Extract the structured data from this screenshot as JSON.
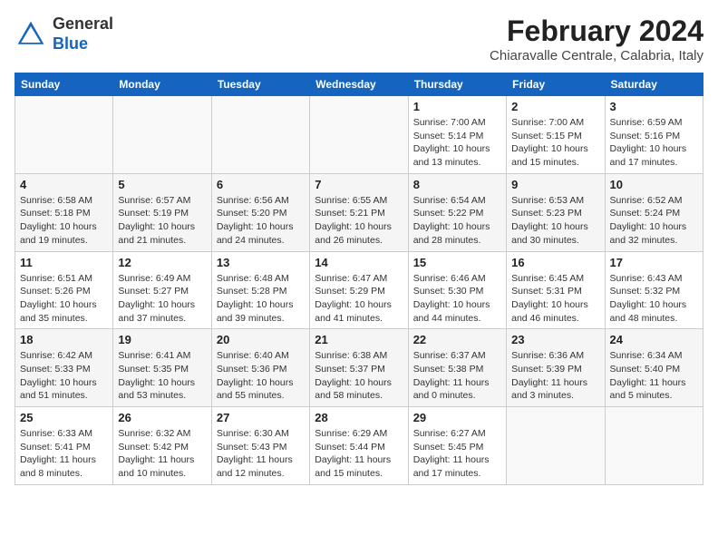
{
  "logo": {
    "general": "General",
    "blue": "Blue"
  },
  "title": "February 2024",
  "subtitle": "Chiaravalle Centrale, Calabria, Italy",
  "days_of_week": [
    "Sunday",
    "Monday",
    "Tuesday",
    "Wednesday",
    "Thursday",
    "Friday",
    "Saturday"
  ],
  "weeks": [
    [
      {
        "day": "",
        "info": ""
      },
      {
        "day": "",
        "info": ""
      },
      {
        "day": "",
        "info": ""
      },
      {
        "day": "",
        "info": ""
      },
      {
        "day": "1",
        "info": "Sunrise: 7:00 AM\nSunset: 5:14 PM\nDaylight: 10 hours\nand 13 minutes."
      },
      {
        "day": "2",
        "info": "Sunrise: 7:00 AM\nSunset: 5:15 PM\nDaylight: 10 hours\nand 15 minutes."
      },
      {
        "day": "3",
        "info": "Sunrise: 6:59 AM\nSunset: 5:16 PM\nDaylight: 10 hours\nand 17 minutes."
      }
    ],
    [
      {
        "day": "4",
        "info": "Sunrise: 6:58 AM\nSunset: 5:18 PM\nDaylight: 10 hours\nand 19 minutes."
      },
      {
        "day": "5",
        "info": "Sunrise: 6:57 AM\nSunset: 5:19 PM\nDaylight: 10 hours\nand 21 minutes."
      },
      {
        "day": "6",
        "info": "Sunrise: 6:56 AM\nSunset: 5:20 PM\nDaylight: 10 hours\nand 24 minutes."
      },
      {
        "day": "7",
        "info": "Sunrise: 6:55 AM\nSunset: 5:21 PM\nDaylight: 10 hours\nand 26 minutes."
      },
      {
        "day": "8",
        "info": "Sunrise: 6:54 AM\nSunset: 5:22 PM\nDaylight: 10 hours\nand 28 minutes."
      },
      {
        "day": "9",
        "info": "Sunrise: 6:53 AM\nSunset: 5:23 PM\nDaylight: 10 hours\nand 30 minutes."
      },
      {
        "day": "10",
        "info": "Sunrise: 6:52 AM\nSunset: 5:24 PM\nDaylight: 10 hours\nand 32 minutes."
      }
    ],
    [
      {
        "day": "11",
        "info": "Sunrise: 6:51 AM\nSunset: 5:26 PM\nDaylight: 10 hours\nand 35 minutes."
      },
      {
        "day": "12",
        "info": "Sunrise: 6:49 AM\nSunset: 5:27 PM\nDaylight: 10 hours\nand 37 minutes."
      },
      {
        "day": "13",
        "info": "Sunrise: 6:48 AM\nSunset: 5:28 PM\nDaylight: 10 hours\nand 39 minutes."
      },
      {
        "day": "14",
        "info": "Sunrise: 6:47 AM\nSunset: 5:29 PM\nDaylight: 10 hours\nand 41 minutes."
      },
      {
        "day": "15",
        "info": "Sunrise: 6:46 AM\nSunset: 5:30 PM\nDaylight: 10 hours\nand 44 minutes."
      },
      {
        "day": "16",
        "info": "Sunrise: 6:45 AM\nSunset: 5:31 PM\nDaylight: 10 hours\nand 46 minutes."
      },
      {
        "day": "17",
        "info": "Sunrise: 6:43 AM\nSunset: 5:32 PM\nDaylight: 10 hours\nand 48 minutes."
      }
    ],
    [
      {
        "day": "18",
        "info": "Sunrise: 6:42 AM\nSunset: 5:33 PM\nDaylight: 10 hours\nand 51 minutes."
      },
      {
        "day": "19",
        "info": "Sunrise: 6:41 AM\nSunset: 5:35 PM\nDaylight: 10 hours\nand 53 minutes."
      },
      {
        "day": "20",
        "info": "Sunrise: 6:40 AM\nSunset: 5:36 PM\nDaylight: 10 hours\nand 55 minutes."
      },
      {
        "day": "21",
        "info": "Sunrise: 6:38 AM\nSunset: 5:37 PM\nDaylight: 10 hours\nand 58 minutes."
      },
      {
        "day": "22",
        "info": "Sunrise: 6:37 AM\nSunset: 5:38 PM\nDaylight: 11 hours\nand 0 minutes."
      },
      {
        "day": "23",
        "info": "Sunrise: 6:36 AM\nSunset: 5:39 PM\nDaylight: 11 hours\nand 3 minutes."
      },
      {
        "day": "24",
        "info": "Sunrise: 6:34 AM\nSunset: 5:40 PM\nDaylight: 11 hours\nand 5 minutes."
      }
    ],
    [
      {
        "day": "25",
        "info": "Sunrise: 6:33 AM\nSunset: 5:41 PM\nDaylight: 11 hours\nand 8 minutes."
      },
      {
        "day": "26",
        "info": "Sunrise: 6:32 AM\nSunset: 5:42 PM\nDaylight: 11 hours\nand 10 minutes."
      },
      {
        "day": "27",
        "info": "Sunrise: 6:30 AM\nSunset: 5:43 PM\nDaylight: 11 hours\nand 12 minutes."
      },
      {
        "day": "28",
        "info": "Sunrise: 6:29 AM\nSunset: 5:44 PM\nDaylight: 11 hours\nand 15 minutes."
      },
      {
        "day": "29",
        "info": "Sunrise: 6:27 AM\nSunset: 5:45 PM\nDaylight: 11 hours\nand 17 minutes."
      },
      {
        "day": "",
        "info": ""
      },
      {
        "day": "",
        "info": ""
      }
    ]
  ]
}
